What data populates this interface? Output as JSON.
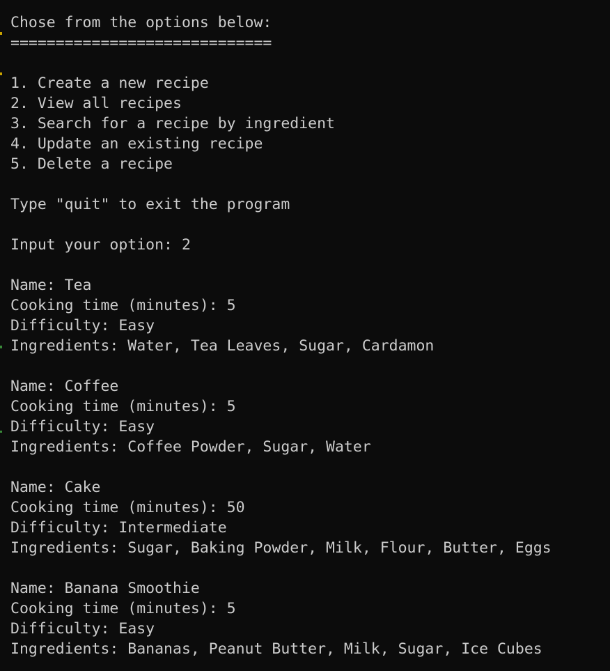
{
  "menu": {
    "heading": "Chose from the options below:",
    "divider": "=============================",
    "options": [
      "1. Create a new recipe",
      "2. View all recipes",
      "3. Search for a recipe by ingredient",
      "4. Update an existing recipe",
      "5. Delete a recipe"
    ],
    "quit_hint": "Type \"quit\" to exit the program",
    "prompt_label": "Input your option: ",
    "prompt_value": "2"
  },
  "recipes": [
    {
      "name": "Name: Tea",
      "cooking_time": "Cooking time (minutes): 5",
      "difficulty": "Difficulty: Easy",
      "ingredients": "Ingredients: Water, Tea Leaves, Sugar, Cardamon"
    },
    {
      "name": "Name: Coffee",
      "cooking_time": "Cooking time (minutes): 5",
      "difficulty": "Difficulty: Easy",
      "ingredients": "Ingredients: Coffee Powder, Sugar, Water"
    },
    {
      "name": "Name: Cake",
      "cooking_time": "Cooking time (minutes): 50",
      "difficulty": "Difficulty: Intermediate",
      "ingredients": "Ingredients: Sugar, Baking Powder, Milk, Flour, Butter, Eggs"
    },
    {
      "name": "Name: Banana Smoothie",
      "cooking_time": "Cooking time (minutes): 5",
      "difficulty": "Difficulty: Easy",
      "ingredients": "Ingredients: Bananas, Peanut Butter, Milk, Sugar, Ice Cubes"
    }
  ],
  "colors": {
    "background": "#0c0c0c",
    "text": "#cccccc",
    "edge_accent_yellow": "#c8a200",
    "edge_accent_green": "#3a8a3a"
  }
}
